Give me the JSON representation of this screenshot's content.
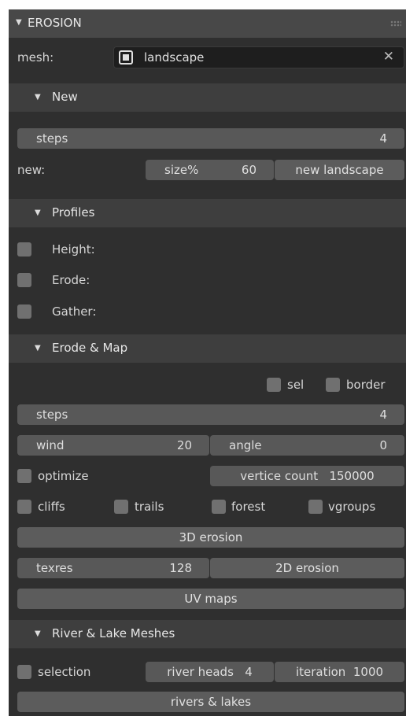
{
  "panel": {
    "title": "EROSION"
  },
  "mesh": {
    "label": "mesh:",
    "value": "landscape"
  },
  "sections": {
    "new": "New",
    "profiles": "Profiles",
    "erode_map": "Erode & Map",
    "river_lake": "River & Lake Meshes"
  },
  "new": {
    "steps_label": "steps",
    "steps_value": "4",
    "row_label": "new:",
    "size_label": "size%",
    "size_value": "60",
    "new_landscape": "new landscape"
  },
  "profiles": {
    "height": "Height:",
    "erode": "Erode:",
    "gather": "Gather:"
  },
  "erode": {
    "sel": "sel",
    "border": "border",
    "steps_label": "steps",
    "steps_value": "4",
    "wind_label": "wind",
    "wind_value": "20",
    "angle_label": "angle",
    "angle_value": "0",
    "optimize": "optimize",
    "vertice_label": "vertice count",
    "vertice_value": "150000",
    "cliffs": "cliffs",
    "trails": "trails",
    "forest": "forest",
    "vgroups": "vgroups",
    "erosion3d": "3D erosion",
    "texres_label": "texres",
    "texres_value": "128",
    "erosion2d": "2D erosion",
    "uvmaps": "UV maps"
  },
  "river": {
    "selection": "selection",
    "heads_label": "river heads",
    "heads_value": "4",
    "iter_label": "iteration",
    "iter_value": "1000",
    "rivers_lakes": "rivers & lakes"
  },
  "icons": [
    "collapse-triangle-icon",
    "drag-grip-icon",
    "mesh-object-icon",
    "clear-x-icon",
    "checkbox-icon"
  ]
}
